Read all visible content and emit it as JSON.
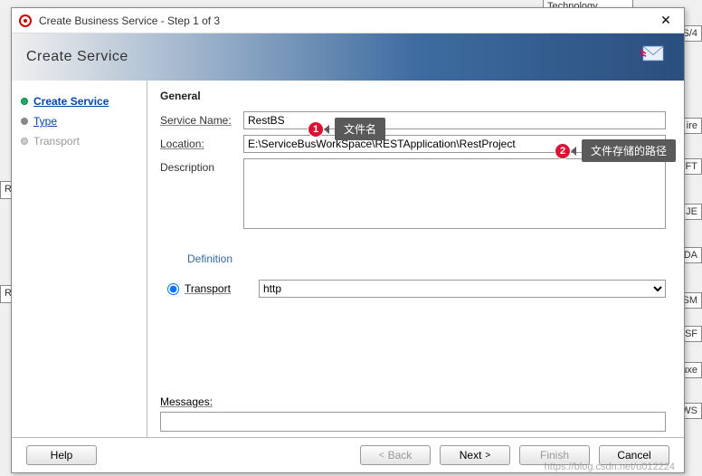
{
  "background": {
    "frags": [
      "Technology",
      "S/4",
      "ire",
      "FT",
      "JE",
      "LDA",
      "MSM",
      "SF",
      "uxe",
      "WS"
    ]
  },
  "titlebar": {
    "title": "Create Business Service - Step 1 of 3",
    "close": "✕"
  },
  "banner": {
    "heading": "Create Service"
  },
  "sidebar": {
    "steps": [
      {
        "label": "Create Service"
      },
      {
        "label": "Type"
      },
      {
        "label": "Transport"
      }
    ]
  },
  "form": {
    "general_title": "General",
    "service_name_label": "Service Name:",
    "service_name_value": "RestBS",
    "location_label": "Location:",
    "location_value": "E:\\ServiceBusWorkSpace\\RESTApplication\\RestProject",
    "description_label": "Description",
    "description_value": "",
    "definition_title": "Definition",
    "transport_label": "Transport",
    "transport_value": "http",
    "messages_label": "Messages:"
  },
  "footer": {
    "help": "Help",
    "back": "Back",
    "next": "Next",
    "finish": "Finish",
    "cancel": "Cancel"
  },
  "annotations": {
    "a1_num": "1",
    "a1_text": "文件名",
    "a2_num": "2",
    "a2_text": "文件存储的路径"
  },
  "watermark": "https://blog.csdn.net/u012224"
}
